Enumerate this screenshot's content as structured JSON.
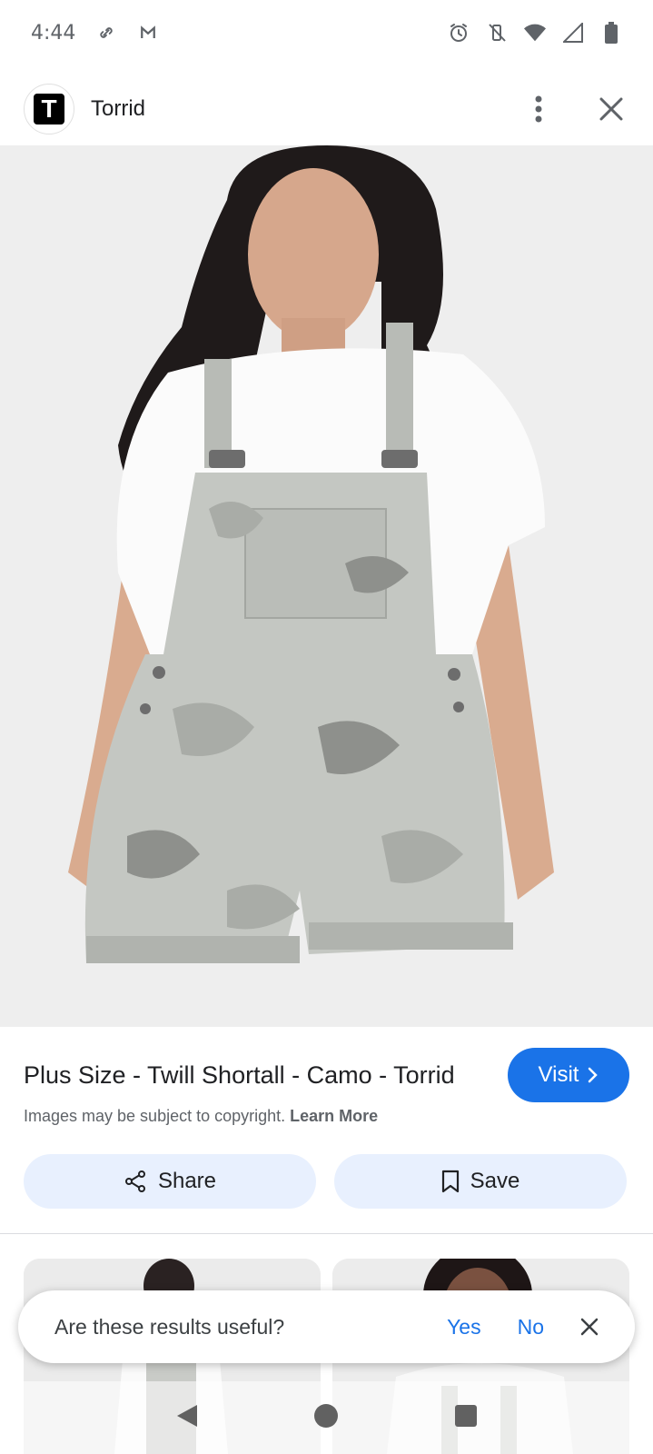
{
  "status_bar": {
    "time": "4:44",
    "left_icons": [
      "link-icon",
      "gmail-icon"
    ],
    "right_icons": [
      "alarm-icon",
      "vibrate-off-icon",
      "wifi-icon",
      "signal-icon",
      "battery-icon"
    ]
  },
  "header": {
    "logo_letter": "T",
    "site_name": "Torrid"
  },
  "result": {
    "title": "Plus Size - Twill Shortall - Camo - Torrid",
    "visit_label": "Visit",
    "copyright_text": "Images may be subject to copyright.",
    "learn_more_label": "Learn More",
    "share_label": "Share",
    "save_label": "Save"
  },
  "feedback": {
    "question": "Are these results useful?",
    "yes_label": "Yes",
    "no_label": "No"
  },
  "colors": {
    "accent": "#1a73e8",
    "pill_bg": "#e8f0fe",
    "camo_light": "#c4c7c2",
    "camo_mid": "#a9aca7",
    "camo_dark": "#8e908c"
  }
}
